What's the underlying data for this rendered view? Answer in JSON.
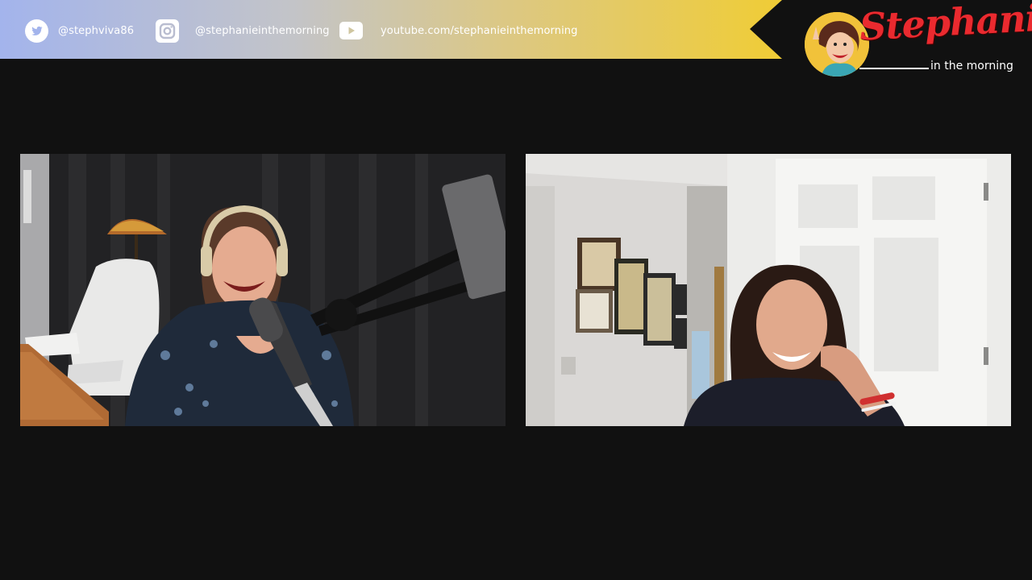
{
  "banner": {
    "social": [
      {
        "icon": "twitter-icon",
        "handle": "@stephviva86"
      },
      {
        "icon": "instagram-icon",
        "handle": "@stephanieinthemorning"
      },
      {
        "icon": "youtube-icon",
        "handle": "youtube.com/stephanieinthemorning"
      }
    ]
  },
  "logo": {
    "name": "Stephanie",
    "subtitle": "in the morning"
  },
  "colors": {
    "background": "#111111",
    "banner_start": "#a3b4ec",
    "banner_end": "#f2cd2c",
    "logo_red": "#ea2a2f"
  },
  "participants": [
    {
      "role": "host-video-feed"
    },
    {
      "role": "guest-video-feed"
    }
  ]
}
